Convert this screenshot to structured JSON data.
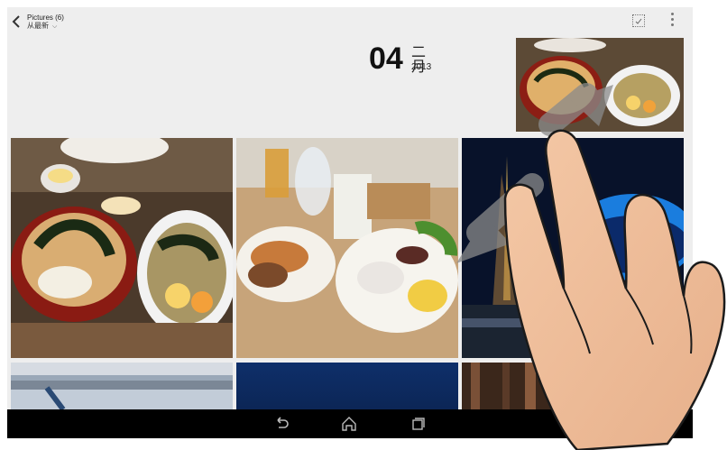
{
  "header": {
    "album_title": "Pictures (6)",
    "sort_label": "从最新",
    "sort_chevron": "⌵",
    "back_icon": "chevron-left-icon",
    "select_icon": "select-checkbox-icon",
    "menu_icon": "more-vertical-icon"
  },
  "date": {
    "day": "04",
    "month": "二月",
    "year": "2013"
  },
  "photos": [
    {
      "label": "ramen-thumbnail"
    },
    {
      "label": "ramen"
    },
    {
      "label": "breakfast"
    },
    {
      "label": "night-tower"
    },
    {
      "label": "snow-field"
    },
    {
      "label": "blue-sky"
    },
    {
      "label": "wooden"
    }
  ],
  "navbar": {
    "back_icon": "back-arrow-icon",
    "home_icon": "home-icon",
    "recents_icon": "recent-apps-icon"
  },
  "overlay": {
    "gesture": "pinch-zoom-hand"
  }
}
